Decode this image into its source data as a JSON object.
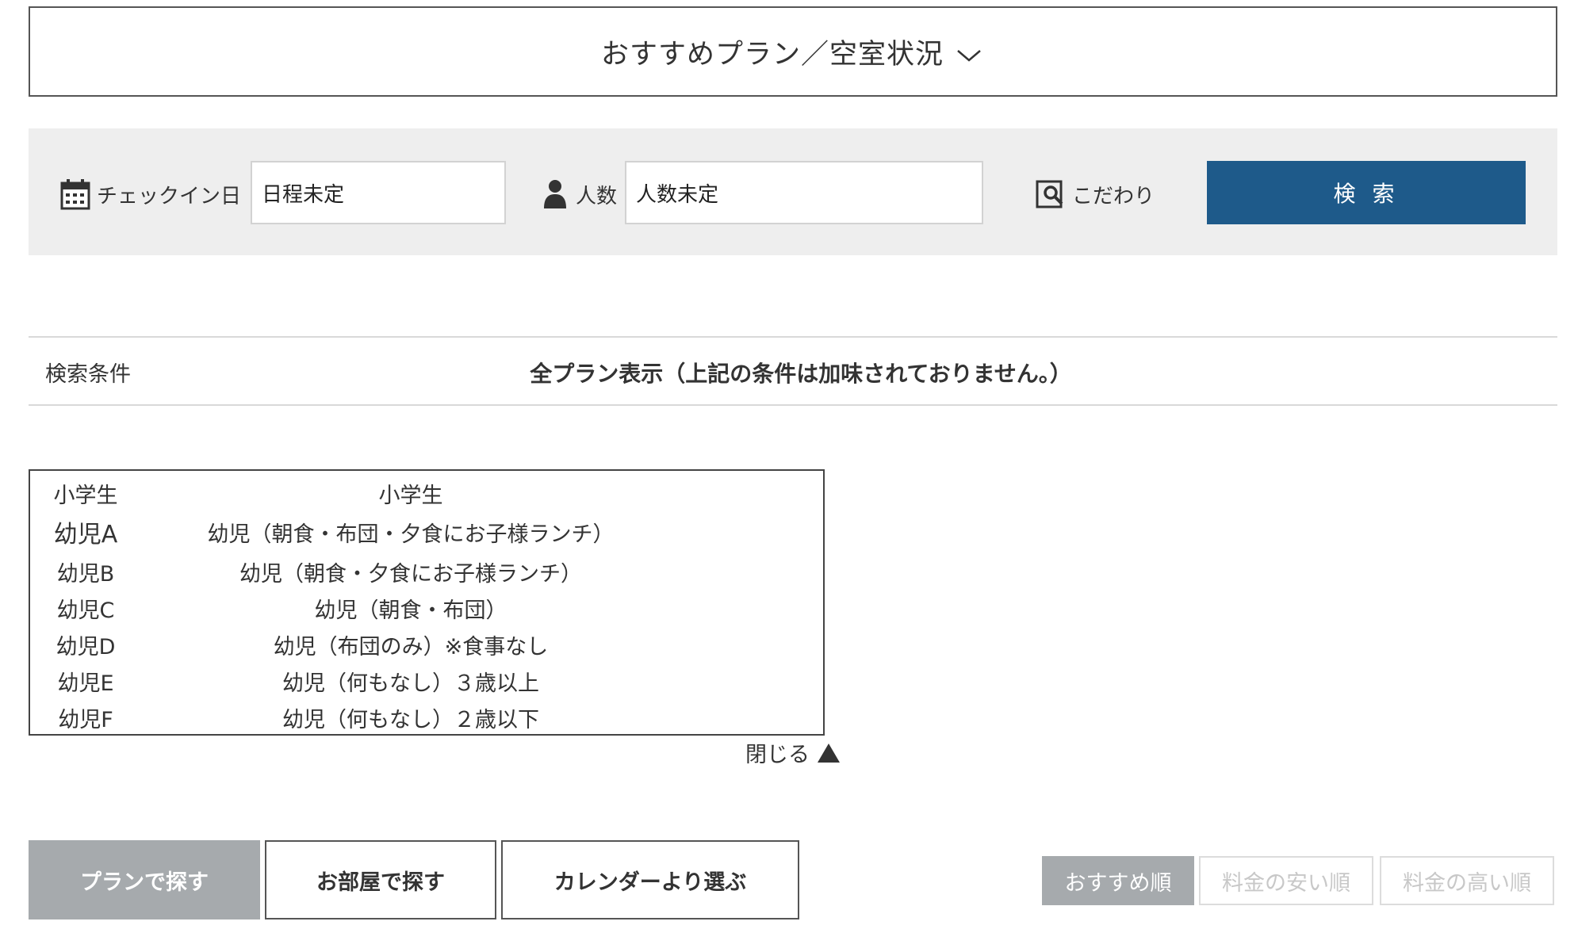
{
  "header": {
    "title": "おすすめプラン／空室状況"
  },
  "search": {
    "checkin_label": "チェックイン日",
    "checkin_value": "日程未定",
    "people_label": "人数",
    "people_value": "人数未定",
    "preferences_label": "こだわり",
    "button_label": "検 索"
  },
  "conditions": {
    "label": "検索条件",
    "text": "全プラン表示（上記の条件は加味されておりません。）"
  },
  "child_types": {
    "rows": [
      {
        "code": "小学生",
        "description": "小学生"
      },
      {
        "code": "幼児A",
        "description": "幼児（朝食・布団・夕食にお子様ランチ）"
      },
      {
        "code": "幼児B",
        "description": "幼児（朝食・夕食にお子様ランチ）"
      },
      {
        "code": "幼児C",
        "description": "幼児（朝食・布団）"
      },
      {
        "code": "幼児D",
        "description": "幼児（布団のみ）※食事なし"
      },
      {
        "code": "幼児E",
        "description": "幼児（何もなし）３歳以上"
      },
      {
        "code": "幼児F",
        "description": "幼児（何もなし）２歳以下"
      }
    ],
    "close_label": "閉じる"
  },
  "tabs": [
    {
      "label": "プランで探す",
      "active": true
    },
    {
      "label": "お部屋で探す",
      "active": false
    },
    {
      "label": "カレンダーより選ぶ",
      "active": false
    }
  ],
  "sort": [
    {
      "label": "おすすめ順",
      "active": true
    },
    {
      "label": "料金の安い順",
      "active": false
    },
    {
      "label": "料金の高い順",
      "active": false
    }
  ],
  "colors": {
    "search_button": "#1e5a8a",
    "active_tab": "#a6aaad",
    "search_bar_bg": "#eeeeee"
  },
  "icons": {
    "header": "chevron-down-icon",
    "checkin": "calendar-icon",
    "people": "person-icon",
    "preferences": "search-filter-icon",
    "close": "triangle-up-icon"
  }
}
